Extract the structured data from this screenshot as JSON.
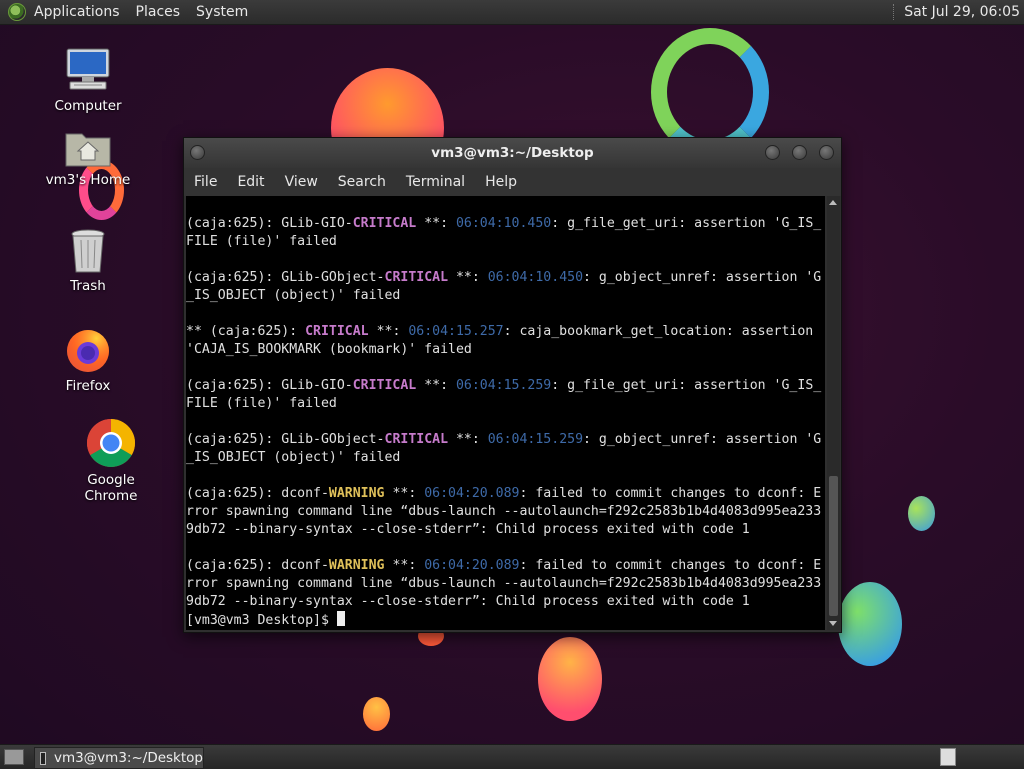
{
  "top_panel": {
    "menus": [
      "Applications",
      "Places",
      "System"
    ],
    "clock": "Sat Jul 29, 06:05"
  },
  "desktop_icons": [
    {
      "label": "Computer",
      "icon": "computer-icon"
    },
    {
      "label": "vm3's Home",
      "icon": "home-folder-icon"
    },
    {
      "label": "Trash",
      "icon": "trash-icon"
    },
    {
      "label": "Firefox",
      "icon": "firefox-icon"
    },
    {
      "label": "Google Chrome",
      "icon": "chrome-icon"
    }
  ],
  "terminal": {
    "title": "vm3@vm3:~/Desktop",
    "menus": [
      "File",
      "Edit",
      "View",
      "Search",
      "Terminal",
      "Help"
    ],
    "colors": {
      "critical": "#c67bcb",
      "warning": "#e0c15a",
      "timestamp": "#3e6aa8"
    },
    "entries": [
      {
        "pre": "(caja:625): GLib-GIO-",
        "level": "CRITICAL",
        "kind": "crit",
        "mid": " **: ",
        "ts": "06:04:10.450",
        "msg": ": g_file_get_uri: assertion 'G_IS_",
        "cont": [
          "FILE (file)' failed"
        ]
      },
      {
        "pre": "(caja:625): GLib-GObject-",
        "level": "CRITICAL",
        "kind": "crit",
        "mid": " **: ",
        "ts": "06:04:10.450",
        "msg": ": g_object_unref: assertion 'G",
        "cont": [
          "_IS_OBJECT (object)' failed"
        ]
      },
      {
        "pre": "** (caja:625): ",
        "level": "CRITICAL",
        "kind": "crit",
        "mid": " **: ",
        "ts": "06:04:15.257",
        "msg": ": caja_bookmark_get_location: assertion",
        "cont": [
          "'CAJA_IS_BOOKMARK (bookmark)' failed"
        ]
      },
      {
        "pre": "(caja:625): GLib-GIO-",
        "level": "CRITICAL",
        "kind": "crit",
        "mid": " **: ",
        "ts": "06:04:15.259",
        "msg": ": g_file_get_uri: assertion 'G_IS_",
        "cont": [
          "FILE (file)' failed"
        ]
      },
      {
        "pre": "(caja:625): GLib-GObject-",
        "level": "CRITICAL",
        "kind": "crit",
        "mid": " **: ",
        "ts": "06:04:15.259",
        "msg": ": g_object_unref: assertion 'G",
        "cont": [
          "_IS_OBJECT (object)' failed"
        ]
      },
      {
        "pre": "(caja:625): dconf-",
        "level": "WARNING",
        "kind": "warn",
        "mid": " **: ",
        "ts": "06:04:20.089",
        "msg": ": failed to commit changes to dconf: E",
        "cont": [
          "rror spawning command line “dbus-launch --autolaunch=f292c2583b1b4d4083d995ea233",
          "9db72 --binary-syntax --close-stderr”: Child process exited with code 1"
        ]
      },
      {
        "pre": "(caja:625): dconf-",
        "level": "WARNING",
        "kind": "warn",
        "mid": " **: ",
        "ts": "06:04:20.089",
        "msg": ": failed to commit changes to dconf: E",
        "cont": [
          "rror spawning command line “dbus-launch --autolaunch=f292c2583b1b4d4083d995ea233",
          "9db72 --binary-syntax --close-stderr”: Child process exited with code 1"
        ]
      }
    ],
    "prompt": "[vm3@vm3 Desktop]$ "
  },
  "taskbar": {
    "task_label": "vm3@vm3:~/Desktop"
  }
}
